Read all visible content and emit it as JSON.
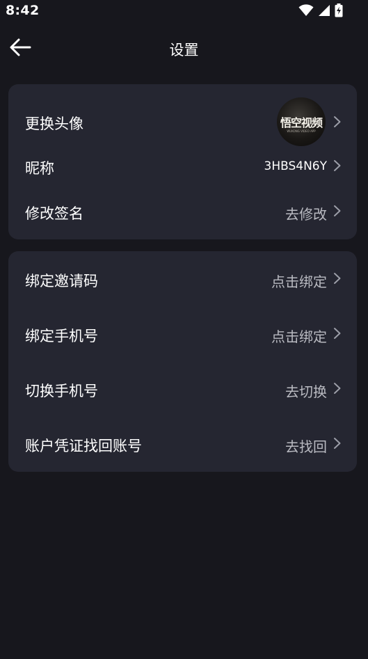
{
  "status_bar": {
    "time": "8:42",
    "icons": [
      "wifi-icon",
      "signal-icon",
      "battery-charging-icon"
    ]
  },
  "header": {
    "title": "设置",
    "back_icon": "back-arrow-icon"
  },
  "colors": {
    "background": "#17171d",
    "card": "#252631",
    "primary_text": "#ffffff",
    "secondary_text": "#b9bac1",
    "chevron": "#9c9ea8"
  },
  "profile_card": {
    "avatar": {
      "label": "更换头像",
      "image_text": "悟空视频",
      "image_subtext": "WUKONG VIDEO APP"
    },
    "nickname": {
      "label": "昵称",
      "value": "3HBS4N6Y"
    },
    "signature": {
      "label": "修改签名",
      "value": "去修改"
    }
  },
  "account_card": {
    "invite_code": {
      "label": "绑定邀请码",
      "value": "点击绑定"
    },
    "bind_phone": {
      "label": "绑定手机号",
      "value": "点击绑定"
    },
    "switch_phone": {
      "label": "切换手机号",
      "value": "去切换"
    },
    "recover_account": {
      "label": "账户凭证找回账号",
      "value": "去找回"
    }
  }
}
